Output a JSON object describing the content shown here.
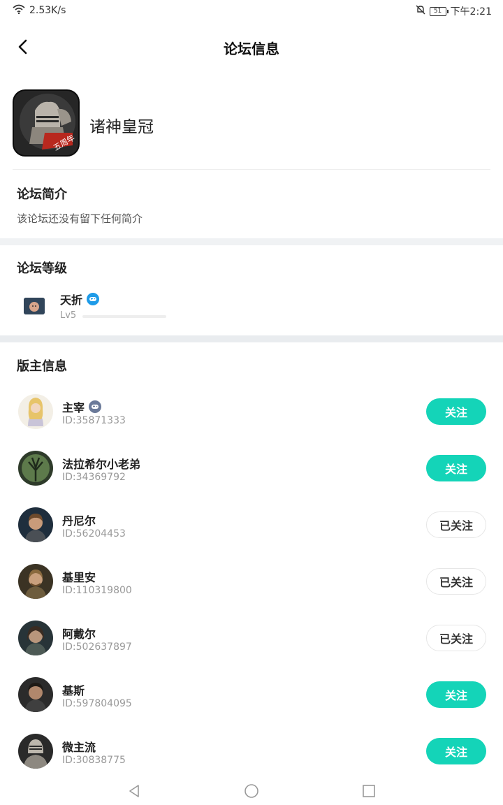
{
  "status_bar": {
    "speed": "2.53K/s",
    "battery": "51",
    "time": "下午2:21"
  },
  "header": {
    "title": "论坛信息"
  },
  "game": {
    "name": "诸神皇冠",
    "icon": "game-knight-icon",
    "icon_badge": "五周年"
  },
  "intro": {
    "title": "论坛简介",
    "text": "该论坛还没有留下任何简介"
  },
  "level": {
    "title": "论坛等级",
    "name": "天折",
    "lv": "Lv5",
    "progress_fraction": 0.0
  },
  "moderators": {
    "title": "版主信息",
    "items": [
      {
        "name": "主宰",
        "id": "ID:35871333",
        "follow": "关注",
        "followed": false,
        "badge": true
      },
      {
        "name": "法拉希尔小老弟",
        "id": "ID:34369792",
        "follow": "关注",
        "followed": false,
        "badge": false
      },
      {
        "name": "丹尼尔",
        "id": "ID:56204453",
        "follow": "已关注",
        "followed": true,
        "badge": false
      },
      {
        "name": "基里安",
        "id": "ID:110319800",
        "follow": "已关注",
        "followed": true,
        "badge": false
      },
      {
        "name": "阿戴尔",
        "id": "ID:502637897",
        "follow": "已关注",
        "followed": true,
        "badge": false
      },
      {
        "name": "基斯",
        "id": "ID:597804095",
        "follow": "关注",
        "followed": false,
        "badge": false
      },
      {
        "name": "微主流",
        "id": "ID:30838775",
        "follow": "关注",
        "followed": false,
        "badge": false
      }
    ]
  },
  "colors": {
    "accent": "#14d4b8",
    "badge_blue": "#1e9be8",
    "badge_gray": "#6b7a99"
  }
}
